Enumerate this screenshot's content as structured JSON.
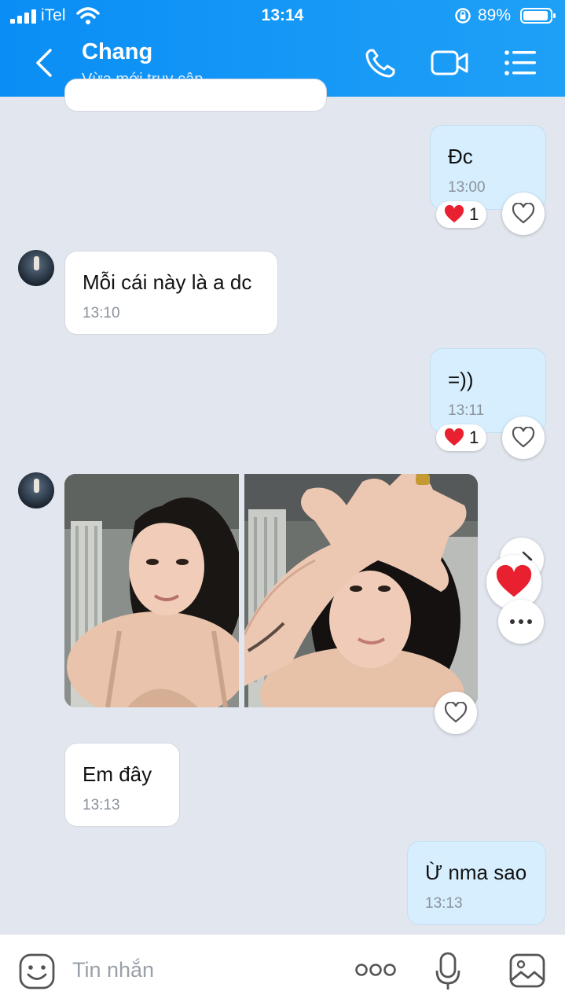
{
  "status": {
    "carrier": "iTel",
    "time": "13:14",
    "battery": "89%"
  },
  "header": {
    "title": "Chang",
    "subtitle": "Vừa mới truy cập"
  },
  "messages": {
    "m1": {
      "text": "Đc",
      "time": "13:00",
      "reaction_count": "1"
    },
    "m2": {
      "text": "Mỗi cái này là a dc",
      "time": "13:10"
    },
    "m3": {
      "text": "=))",
      "time": "13:11",
      "reaction_count": "1"
    },
    "m5": {
      "text": "Em đây",
      "time": "13:13"
    },
    "m6": {
      "text": "Ừ nma sao",
      "time": "13:13"
    }
  },
  "input": {
    "placeholder": "Tin nhắn"
  },
  "colors": {
    "header": "#0a8ef5",
    "outgoing_bubble": "#d6eefe",
    "incoming_bubble": "#ffffff",
    "heart": "#e8202f"
  },
  "icons": [
    "back-icon",
    "phone-icon",
    "video-icon",
    "menu-icon",
    "sticker-icon",
    "more-icon",
    "mic-icon",
    "image-icon",
    "heart-icon"
  ]
}
